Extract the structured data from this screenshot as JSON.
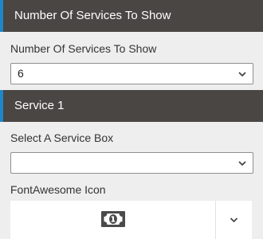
{
  "sections": {
    "services_count": {
      "header_title": "Number Of Services To Show",
      "field_label": "Number Of Services To Show",
      "selected_value": "6"
    },
    "service_1": {
      "header_title": "Service 1",
      "service_box_label": "Select A Service Box",
      "service_box_value": "",
      "icon_label": "FontAwesome Icon",
      "icon_selected": "money-bill-icon"
    }
  },
  "colors": {
    "header_bg": "#4a4644",
    "header_accent": "#1e87c8",
    "panel_bg": "#eeeeee"
  }
}
